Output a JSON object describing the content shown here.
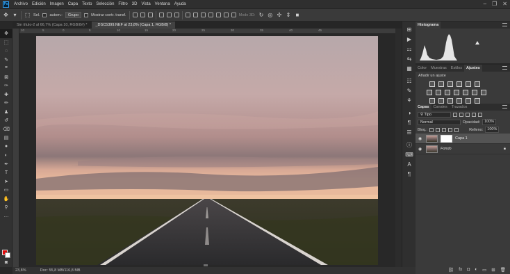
{
  "menu": [
    "Archivo",
    "Edición",
    "Imagen",
    "Capa",
    "Texto",
    "Selección",
    "Filtro",
    "3D",
    "Vista",
    "Ventana",
    "Ayuda"
  ],
  "options": {
    "select_label": "Sel.",
    "auto_label": "autom.:",
    "group_value": "Grupo",
    "transform_label": "Mostrar contr. transf.",
    "mode3d_label": "Modo 3D:"
  },
  "tabs": [
    "Sin título-2 al 66,7% (Capa 10, RGB/8#) *",
    "_DSC5399.NEF al 23,8% (Capa 1, RGB/8) *"
  ],
  "ruler": [
    "10",
    "5",
    "0",
    "5",
    "10",
    "15",
    "20",
    "25",
    "30",
    "35",
    "40",
    "45"
  ],
  "status": {
    "zoom": "23,8%",
    "doc": "Doc: 55,8 MB/116,8 MB"
  },
  "panels": {
    "histogram_tab": "Histograma",
    "adjust_tabs": [
      "Color",
      "Muestras",
      "Estilos",
      "Ajustes"
    ],
    "adjust_title": "Añadir un ajuste",
    "layer_tabs": [
      "Capas",
      "Canales",
      "Trazados"
    ],
    "filter_value": "Tipo",
    "blend_mode": "Normal",
    "opacity_label": "Opacidad:",
    "opacity_value": "100%",
    "lock_label": "Bloq.:",
    "fill_label": "Relleno:",
    "fill_value": "100%",
    "layers": [
      {
        "name": "Capa 1",
        "selected": true
      },
      {
        "name": "Fondo",
        "selected": false
      }
    ]
  },
  "colors": {
    "foreground": "#e00b0b",
    "background": "#ffffff",
    "accent": "#31a8ff"
  }
}
